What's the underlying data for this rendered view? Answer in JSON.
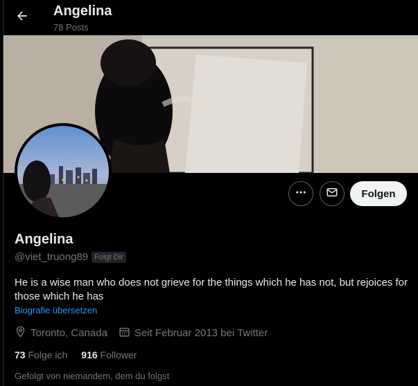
{
  "header": {
    "title": "Angelina",
    "posts_count": "78 Posts"
  },
  "profile": {
    "display_name": "Angelina",
    "handle": "@viet_truong89",
    "follows_you_badge": "Folgt Dir",
    "bio": "He is a wise man who does not grieve for the things which he has not, but rejoices for those which he has",
    "translate_label": "Biografie übersetzen",
    "location": "Toronto, Canada",
    "joined": "Seit Februar 2013 bei Twitter",
    "following_count": "73",
    "following_label": "Folge ich",
    "followers_count": "916",
    "followers_label": "Follower",
    "followed_by_note": "Gefolgt von niemandem, dem du folgst"
  },
  "actions": {
    "follow_label": "Folgen"
  },
  "icons": {
    "back": "arrow-left-icon",
    "more": "more-horizontal-icon",
    "message": "envelope-icon",
    "location": "location-pin-icon",
    "calendar": "calendar-icon"
  },
  "colors": {
    "background": "#000000",
    "text_primary": "#e7e9ea",
    "text_secondary": "#71767b",
    "link": "#1d9bf0",
    "follow_button_bg": "#eff3f4"
  }
}
